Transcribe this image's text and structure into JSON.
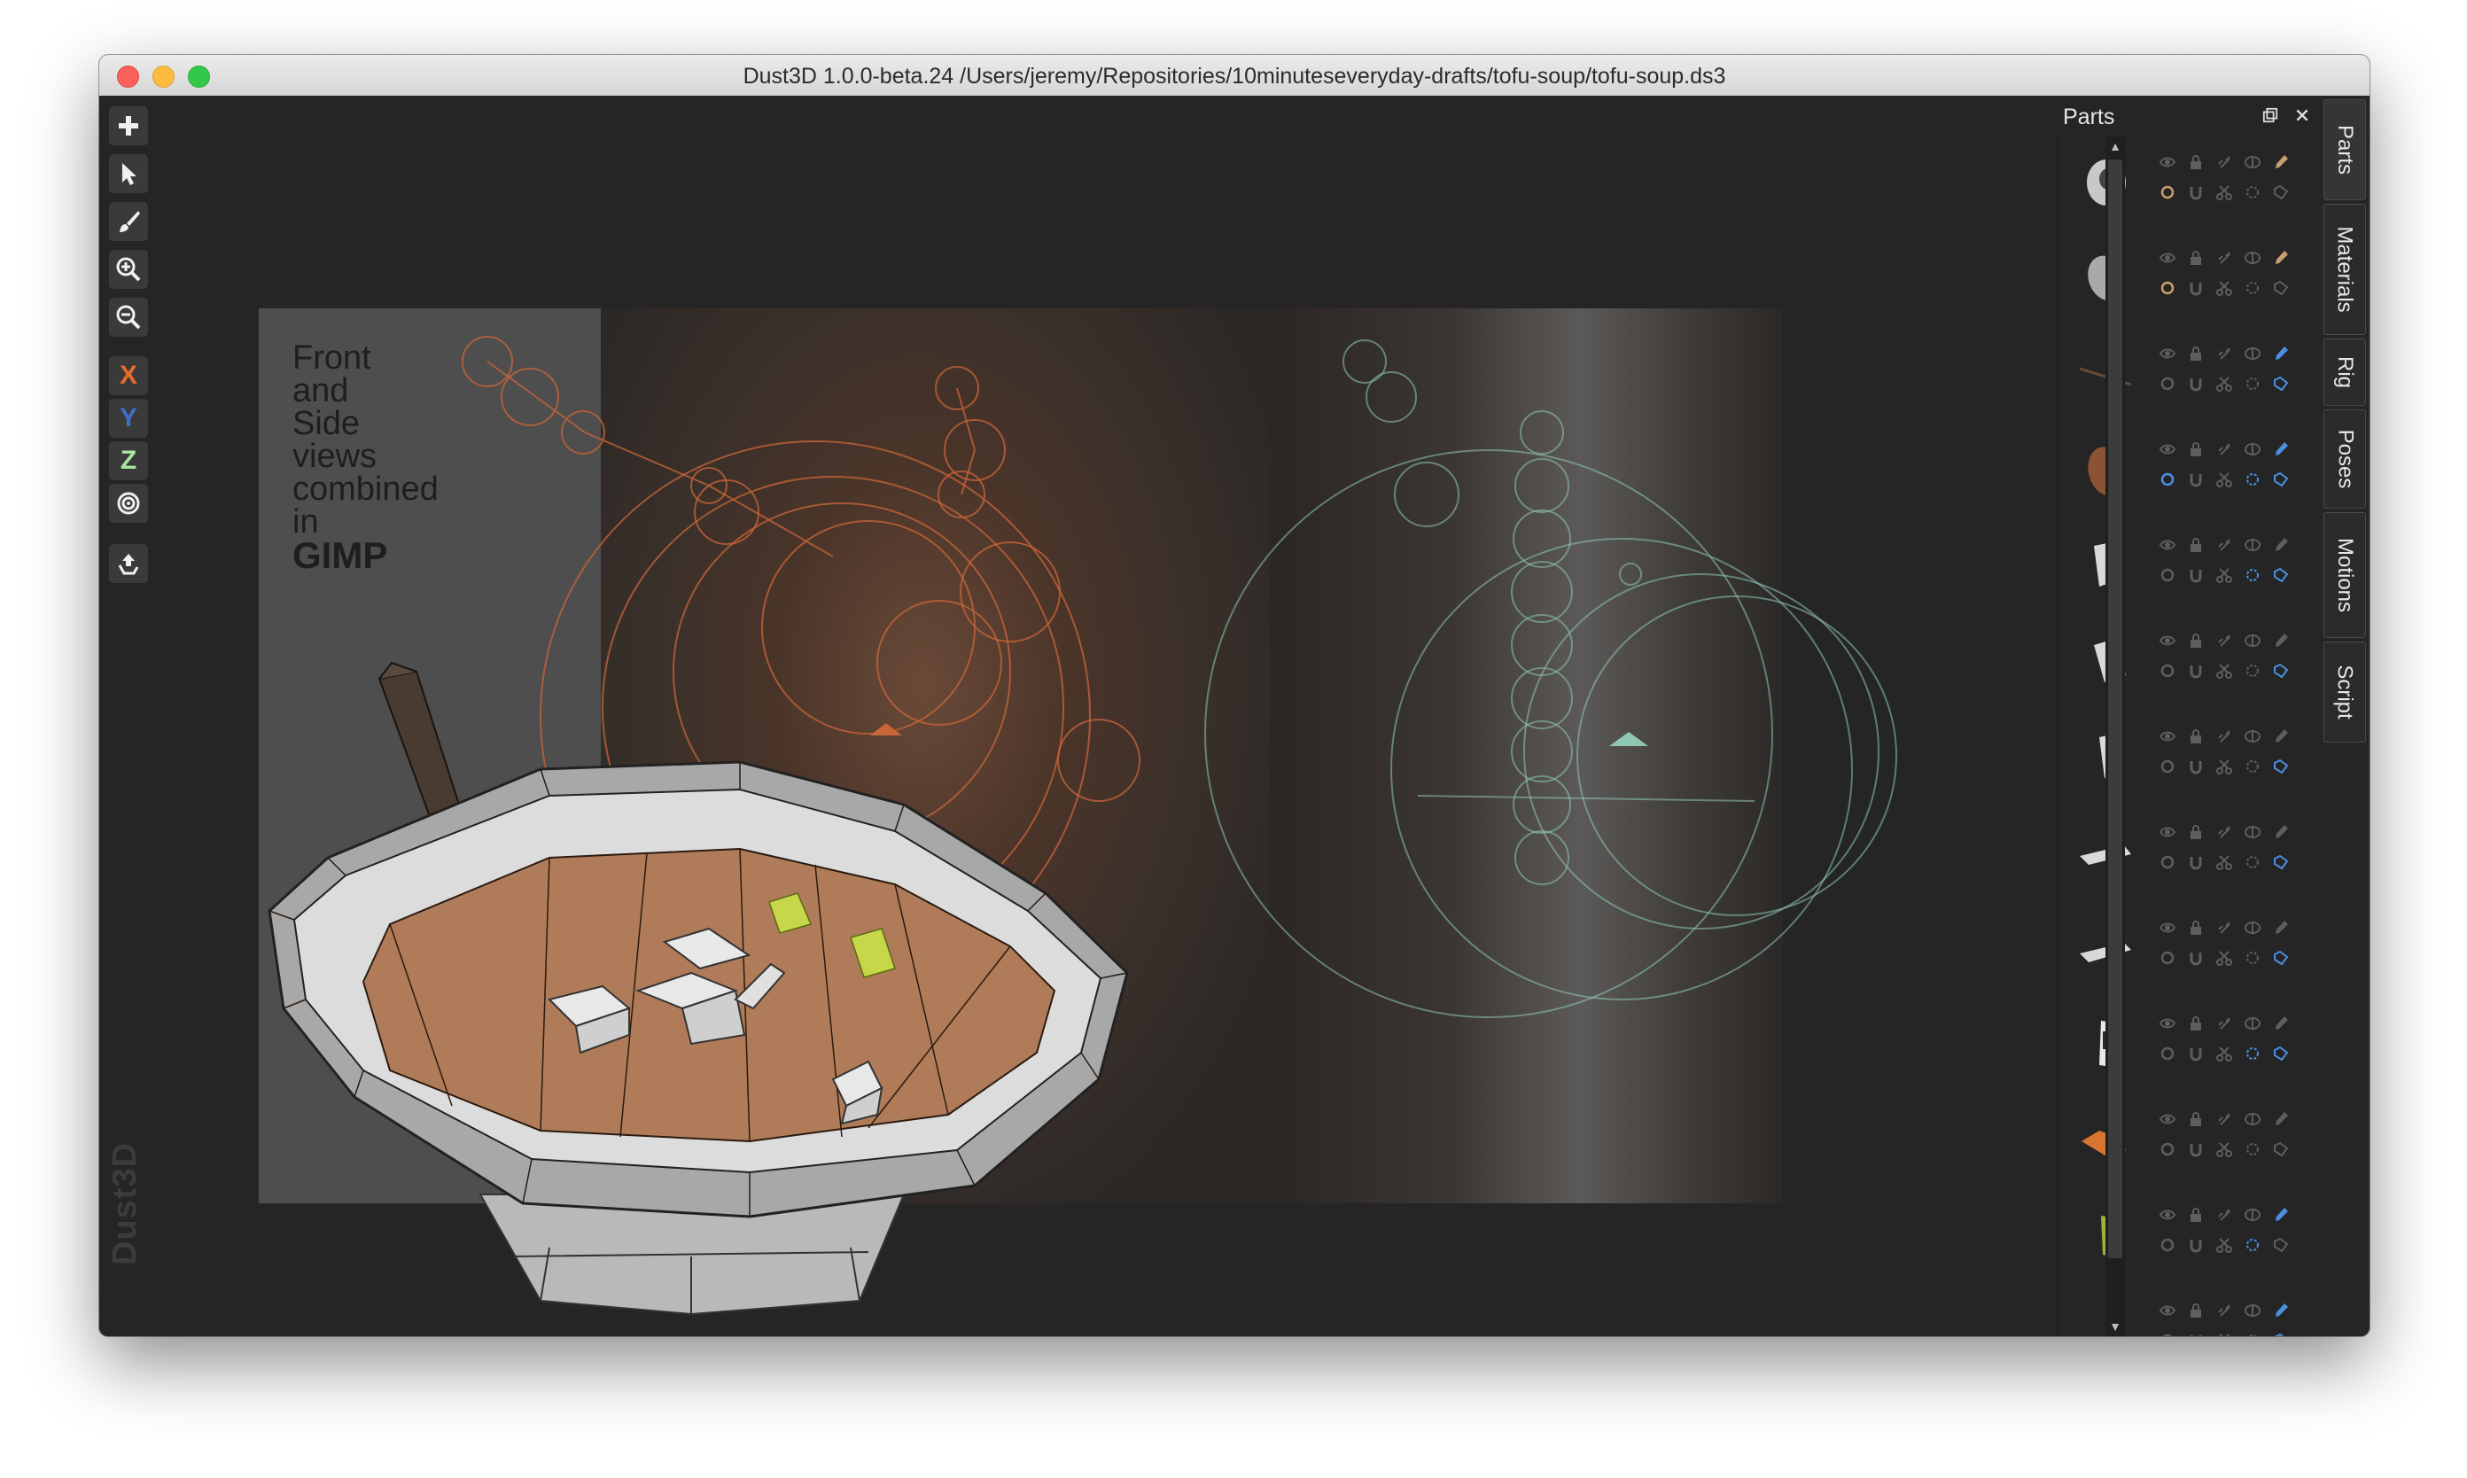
{
  "window": {
    "title": "Dust3D 1.0.0-beta.24 /Users/jeremy/Repositories/10minuteseveryday-drafts/tofu-soup/tofu-soup.ds3"
  },
  "toolbar": {
    "tools": [
      {
        "icon": "add-icon"
      },
      {
        "icon": "select-pointer-icon"
      },
      {
        "icon": "paint-brush-icon"
      },
      {
        "icon": "zoom-in-icon"
      },
      {
        "icon": "zoom-out-icon"
      },
      {
        "icon": "x-axis-icon",
        "label": "X",
        "color": "#e86a2c"
      },
      {
        "icon": "y-axis-icon",
        "label": "Y",
        "color": "#3d6fc9"
      },
      {
        "icon": "z-axis-icon",
        "label": "Z",
        "color": "#a9e6a0"
      },
      {
        "icon": "radial-axis-icon"
      },
      {
        "icon": "regenerate-icon"
      }
    ],
    "watermark": "Dust3D"
  },
  "reference": {
    "caption_lines": [
      "Front",
      "and",
      "Side",
      "views",
      "combined",
      "in"
    ],
    "caption_bold": "GIMP"
  },
  "parts_panel": {
    "title": "Parts",
    "parts": [
      {
        "thumb": "bowl-rim-part",
        "color": "#c8c8c8",
        "active_color": "#c8a070"
      },
      {
        "thumb": "bowl-base-part",
        "color": "#a9a9a9",
        "active_color": "#c8a070"
      },
      {
        "thumb": "spoon-line-part",
        "color": "#6b4a36",
        "active_color": "#4a8fe0"
      },
      {
        "thumb": "soup-disc-part",
        "color": "#8a5434",
        "active_color": "#4a8fe0"
      },
      {
        "thumb": "tofu-block-a",
        "color": "#d9d9d9",
        "active_color": "#4a8fe0"
      },
      {
        "thumb": "tofu-block-b",
        "color": "#d9d9d9",
        "active_color": "#4a8fe0"
      },
      {
        "thumb": "tofu-block-c",
        "color": "#d9d9d9",
        "active_color": "#4a8fe0"
      },
      {
        "thumb": "tofu-slab-a",
        "color": "#d9d9d9",
        "active_color": "#4a8fe0"
      },
      {
        "thumb": "tofu-slab-b",
        "color": "#d9d9d9",
        "active_color": "#4a8fe0"
      },
      {
        "thumb": "spoon-handle-part",
        "color": "#2a2a2a",
        "active_color": "#4a8fe0"
      },
      {
        "thumb": "carrot-part",
        "color": "#d87530",
        "active_color": "#4a8fe0"
      },
      {
        "thumb": "scallion-part",
        "color": "#9ab33a",
        "active_color": "#4a8fe0"
      },
      {
        "thumb": "scallion-stalk-part",
        "color": "#9ab33a",
        "active_color": "#4a8fe0"
      }
    ]
  },
  "tabs": [
    "Parts",
    "Materials",
    "Rig",
    "Poses",
    "Motions",
    "Script"
  ]
}
